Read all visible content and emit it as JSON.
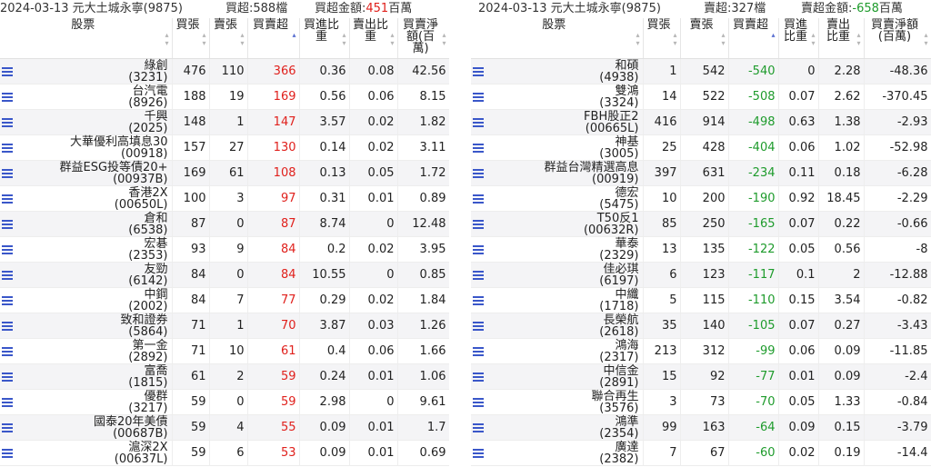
{
  "left": {
    "date": "2024-03-13 元大土城永寧(9875)",
    "summary_label": "買超:588檔",
    "amount_label": "買超金額:",
    "amount_value": "451",
    "amount_unit": "百萬",
    "headers": [
      "股票",
      "買張",
      "賣張",
      "買賣超",
      "買進比重",
      "賣出比重",
      "買賣淨額(百萬)"
    ],
    "rows": [
      {
        "name": "綠創",
        "code": "(3231)",
        "buy": "476",
        "sell": "110",
        "net": "366",
        "buy_pct": "0.36",
        "sell_pct": "0.08",
        "amount": "42.56"
      },
      {
        "name": "台汽電",
        "code": "(8926)",
        "buy": "188",
        "sell": "19",
        "net": "169",
        "buy_pct": "0.56",
        "sell_pct": "0.06",
        "amount": "8.15"
      },
      {
        "name": "千興",
        "code": "(2025)",
        "buy": "148",
        "sell": "1",
        "net": "147",
        "buy_pct": "3.57",
        "sell_pct": "0.02",
        "amount": "1.82"
      },
      {
        "name": "大華優利高填息30",
        "code": "(00918)",
        "buy": "157",
        "sell": "27",
        "net": "130",
        "buy_pct": "0.14",
        "sell_pct": "0.02",
        "amount": "3.11"
      },
      {
        "name": "群益ESG投等債20+",
        "code": "(00937B)",
        "buy": "169",
        "sell": "61",
        "net": "108",
        "buy_pct": "0.13",
        "sell_pct": "0.05",
        "amount": "1.72"
      },
      {
        "name": "香港2X",
        "code": "(00650L)",
        "buy": "100",
        "sell": "3",
        "net": "97",
        "buy_pct": "0.31",
        "sell_pct": "0.01",
        "amount": "0.89"
      },
      {
        "name": "倉和",
        "code": "(6538)",
        "buy": "87",
        "sell": "0",
        "net": "87",
        "buy_pct": "8.74",
        "sell_pct": "0",
        "amount": "12.48"
      },
      {
        "name": "宏碁",
        "code": "(2353)",
        "buy": "93",
        "sell": "9",
        "net": "84",
        "buy_pct": "0.2",
        "sell_pct": "0.02",
        "amount": "3.95"
      },
      {
        "name": "友勁",
        "code": "(6142)",
        "buy": "84",
        "sell": "0",
        "net": "84",
        "buy_pct": "10.55",
        "sell_pct": "0",
        "amount": "0.85"
      },
      {
        "name": "中鋼",
        "code": "(2002)",
        "buy": "84",
        "sell": "7",
        "net": "77",
        "buy_pct": "0.29",
        "sell_pct": "0.02",
        "amount": "1.84"
      },
      {
        "name": "致和證券",
        "code": "(5864)",
        "buy": "71",
        "sell": "1",
        "net": "70",
        "buy_pct": "3.87",
        "sell_pct": "0.03",
        "amount": "1.26"
      },
      {
        "name": "第一金",
        "code": "(2892)",
        "buy": "71",
        "sell": "10",
        "net": "61",
        "buy_pct": "0.4",
        "sell_pct": "0.06",
        "amount": "1.66"
      },
      {
        "name": "富喬",
        "code": "(1815)",
        "buy": "61",
        "sell": "2",
        "net": "59",
        "buy_pct": "0.24",
        "sell_pct": "0.01",
        "amount": "1.06"
      },
      {
        "name": "優群",
        "code": "(3217)",
        "buy": "59",
        "sell": "0",
        "net": "59",
        "buy_pct": "2.98",
        "sell_pct": "0",
        "amount": "9.61"
      },
      {
        "name": "國泰20年美債",
        "code": "(00687B)",
        "buy": "59",
        "sell": "4",
        "net": "55",
        "buy_pct": "0.09",
        "sell_pct": "0.01",
        "amount": "1.7"
      },
      {
        "name": "滬深2X",
        "code": "(00637L)",
        "buy": "59",
        "sell": "6",
        "net": "53",
        "buy_pct": "0.09",
        "sell_pct": "0.01",
        "amount": "0.69"
      }
    ]
  },
  "right": {
    "date": "2024-03-13 元大土城永寧(9875)",
    "summary_label": "賣超:327檔",
    "amount_label": "賣超金額:",
    "amount_value": "-658",
    "amount_unit": "百萬",
    "headers": [
      "股票",
      "買張",
      "賣張",
      "買賣超",
      "買進比重",
      "賣出比重",
      "買賣淨額(百萬)"
    ],
    "rows": [
      {
        "name": "和碩",
        "code": "(4938)",
        "buy": "1",
        "sell": "542",
        "net": "-540",
        "buy_pct": "0",
        "sell_pct": "2.28",
        "amount": "-48.36"
      },
      {
        "name": "雙鴻",
        "code": "(3324)",
        "buy": "14",
        "sell": "522",
        "net": "-508",
        "buy_pct": "0.07",
        "sell_pct": "2.62",
        "amount": "-370.45"
      },
      {
        "name": "FBH股正2",
        "code": "(00665L)",
        "buy": "416",
        "sell": "914",
        "net": "-498",
        "buy_pct": "0.63",
        "sell_pct": "1.38",
        "amount": "-2.93"
      },
      {
        "name": "神基",
        "code": "(3005)",
        "buy": "25",
        "sell": "428",
        "net": "-404",
        "buy_pct": "0.06",
        "sell_pct": "1.02",
        "amount": "-52.98"
      },
      {
        "name": "群益台灣精選高息",
        "code": "(00919)",
        "buy": "397",
        "sell": "631",
        "net": "-234",
        "buy_pct": "0.11",
        "sell_pct": "0.18",
        "amount": "-6.28"
      },
      {
        "name": "德宏",
        "code": "(5475)",
        "buy": "10",
        "sell": "200",
        "net": "-190",
        "buy_pct": "0.92",
        "sell_pct": "18.45",
        "amount": "-2.29"
      },
      {
        "name": "T50反1",
        "code": "(00632R)",
        "buy": "85",
        "sell": "250",
        "net": "-165",
        "buy_pct": "0.07",
        "sell_pct": "0.22",
        "amount": "-0.66"
      },
      {
        "name": "華泰",
        "code": "(2329)",
        "buy": "13",
        "sell": "135",
        "net": "-122",
        "buy_pct": "0.05",
        "sell_pct": "0.56",
        "amount": "-8"
      },
      {
        "name": "佳必琪",
        "code": "(6197)",
        "buy": "6",
        "sell": "123",
        "net": "-117",
        "buy_pct": "0.1",
        "sell_pct": "2",
        "amount": "-12.88"
      },
      {
        "name": "中纖",
        "code": "(1718)",
        "buy": "5",
        "sell": "115",
        "net": "-110",
        "buy_pct": "0.15",
        "sell_pct": "3.54",
        "amount": "-0.82"
      },
      {
        "name": "長榮航",
        "code": "(2618)",
        "buy": "35",
        "sell": "140",
        "net": "-105",
        "buy_pct": "0.07",
        "sell_pct": "0.27",
        "amount": "-3.43"
      },
      {
        "name": "鴻海",
        "code": "(2317)",
        "buy": "213",
        "sell": "312",
        "net": "-99",
        "buy_pct": "0.06",
        "sell_pct": "0.09",
        "amount": "-11.85"
      },
      {
        "name": "中信金",
        "code": "(2891)",
        "buy": "15",
        "sell": "92",
        "net": "-77",
        "buy_pct": "0.01",
        "sell_pct": "0.09",
        "amount": "-2.4"
      },
      {
        "name": "聯合再生",
        "code": "(3576)",
        "buy": "3",
        "sell": "73",
        "net": "-70",
        "buy_pct": "0.05",
        "sell_pct": "1.33",
        "amount": "-0.84"
      },
      {
        "name": "鴻準",
        "code": "(2354)",
        "buy": "99",
        "sell": "163",
        "net": "-64",
        "buy_pct": "0.09",
        "sell_pct": "0.15",
        "amount": "-3.79"
      },
      {
        "name": "廣達",
        "code": "(2382)",
        "buy": "7",
        "sell": "67",
        "net": "-60",
        "buy_pct": "0.02",
        "sell_pct": "0.19",
        "amount": "-14.4"
      }
    ]
  },
  "colors": {
    "positive": "#e0201c",
    "negative": "#1e9b2c",
    "menu_icon": "#3a57c9"
  },
  "icons": {
    "row_menu": "list-menu-icon",
    "sort": "sort-arrows-icon"
  }
}
